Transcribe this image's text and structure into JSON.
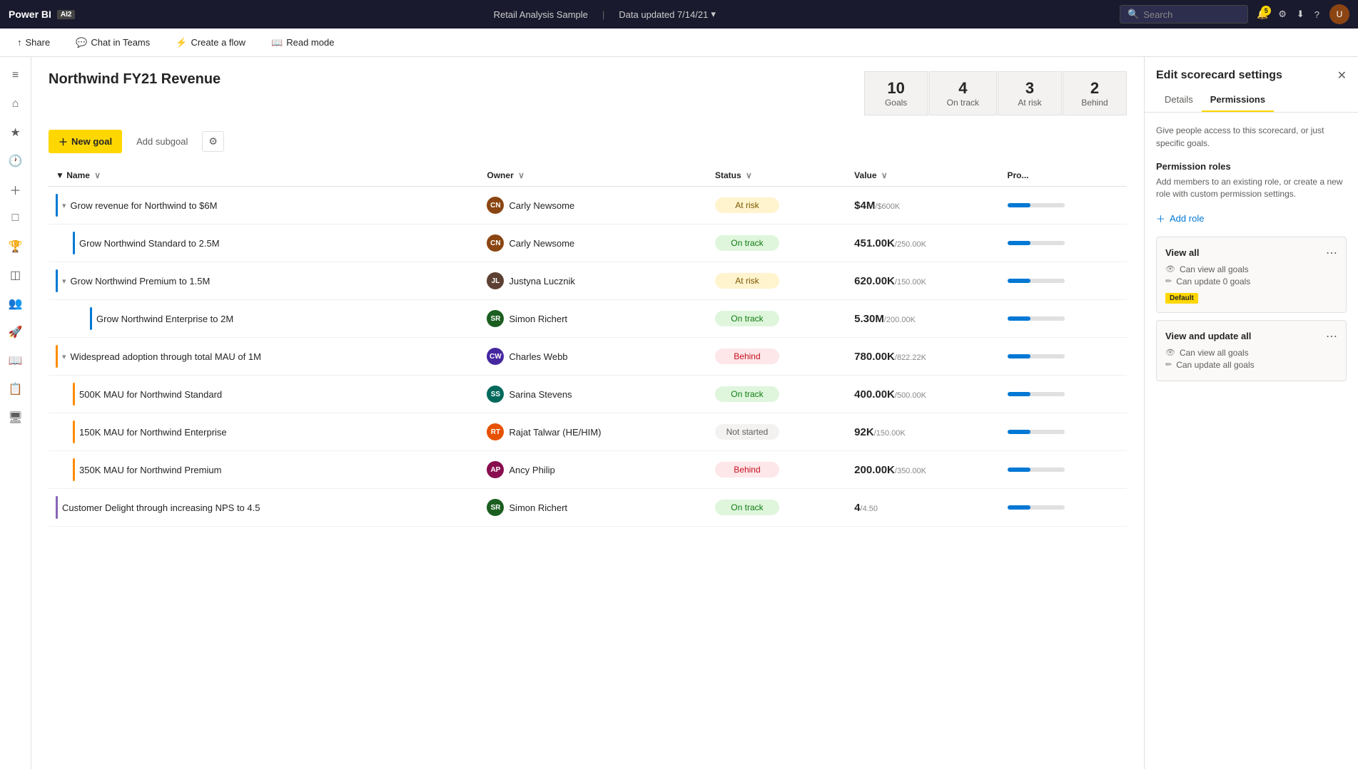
{
  "app": {
    "name": "Power BI",
    "ai_badge": "AI2"
  },
  "topbar": {
    "title": "Retail Analysis Sample",
    "separator": "|",
    "update_text": "Data updated 7/14/21",
    "search_placeholder": "Search",
    "notif_count": "5"
  },
  "secondbar": {
    "share_label": "Share",
    "chat_label": "Chat in Teams",
    "flow_label": "Create a flow",
    "readmode_label": "Read mode"
  },
  "scorecard": {
    "title": "Northwind FY21 Revenue",
    "stats": [
      {
        "value": "10",
        "label": "Goals"
      },
      {
        "value": "4",
        "label": "On track"
      },
      {
        "value": "3",
        "label": "At risk"
      },
      {
        "value": "2",
        "label": "Behind"
      }
    ],
    "toolbar": {
      "new_goal": "New goal",
      "add_subgoal": "Add subgoal"
    },
    "columns": [
      {
        "label": "Name"
      },
      {
        "label": "Owner"
      },
      {
        "label": "Status"
      },
      {
        "label": "Value"
      },
      {
        "label": "Pro..."
      }
    ],
    "goals": [
      {
        "id": 1,
        "name": "Grow revenue for Northwind to $6M",
        "indent": 0,
        "collapsible": true,
        "bar_color": "bar-blue",
        "owner": "Carly Newsome",
        "owner_initials": "CN",
        "owner_color": "#8b4513",
        "status": "At risk",
        "status_class": "status-at-risk",
        "value_main": "$4M",
        "value_sub": "/$600K"
      },
      {
        "id": 2,
        "name": "Grow Northwind Standard to 2.5M",
        "indent": 1,
        "collapsible": false,
        "bar_color": "bar-blue",
        "owner": "Carly Newsome",
        "owner_initials": "CN",
        "owner_color": "#8b4513",
        "status": "On track",
        "status_class": "status-on-track",
        "value_main": "451.00K",
        "value_sub": "/250.00K"
      },
      {
        "id": 3,
        "name": "Grow Northwind Premium to 1.5M",
        "indent": 0,
        "collapsible": true,
        "bar_color": "bar-blue",
        "owner": "Justyna Lucznik",
        "owner_initials": "JL",
        "owner_color": "#5c4033",
        "status": "At risk",
        "status_class": "status-at-risk",
        "value_main": "620.00K",
        "value_sub": "/150.00K"
      },
      {
        "id": 4,
        "name": "Grow Northwind Enterprise to 2M",
        "indent": 2,
        "collapsible": false,
        "bar_color": "bar-blue",
        "owner": "Simon Richert",
        "owner_initials": "SR",
        "owner_color": "#1b5e20",
        "status": "On track",
        "status_class": "status-on-track",
        "value_main": "5.30M",
        "value_sub": "/200.00K"
      },
      {
        "id": 5,
        "name": "Widespread adoption through total MAU of 1M",
        "indent": 0,
        "collapsible": true,
        "bar_color": "bar-orange",
        "owner": "Charles Webb",
        "owner_initials": "CW",
        "owner_color": "#4527a0",
        "status": "Behind",
        "status_class": "status-behind",
        "value_main": "780.00K",
        "value_sub": "/822.22K"
      },
      {
        "id": 6,
        "name": "500K MAU for Northwind Standard",
        "indent": 1,
        "collapsible": false,
        "bar_color": "bar-orange",
        "owner": "Sarina Stevens",
        "owner_initials": "SS",
        "owner_color": "#00695c",
        "status": "On track",
        "status_class": "status-on-track",
        "value_main": "400.00K",
        "value_sub": "/500.00K"
      },
      {
        "id": 7,
        "name": "150K MAU for Northwind Enterprise",
        "indent": 1,
        "collapsible": false,
        "bar_color": "bar-orange",
        "owner": "Rajat Talwar (HE/HIM)",
        "owner_initials": "RT",
        "owner_color": "#e65100",
        "status": "Not started",
        "status_class": "status-not-started",
        "value_main": "92K",
        "value_sub": "/150.00K"
      },
      {
        "id": 8,
        "name": "350K MAU for Northwind Premium",
        "indent": 1,
        "collapsible": false,
        "bar_color": "bar-orange",
        "owner": "Ancy Philip",
        "owner_initials": "AP",
        "owner_color": "#880e4f",
        "status": "Behind",
        "status_class": "status-behind",
        "value_main": "200.00K",
        "value_sub": "/350.00K"
      },
      {
        "id": 9,
        "name": "Customer Delight through increasing NPS to 4.5",
        "indent": 0,
        "collapsible": false,
        "bar_color": "bar-purple",
        "owner": "Simon Richert",
        "owner_initials": "SR",
        "owner_color": "#1b5e20",
        "status": "On track",
        "status_class": "status-on-track",
        "value_main": "4",
        "value_sub": "/4.50"
      }
    ]
  },
  "right_panel": {
    "title": "Edit scorecard settings",
    "tabs": [
      "Details",
      "Permissions"
    ],
    "active_tab": "Permissions",
    "description": "Give people access to this scorecard, or just specific goals.",
    "section_title": "Permission roles",
    "section_sub": "Add members to an existing role, or create a new role with custom permission settings.",
    "add_role_label": "Add role",
    "roles": [
      {
        "title": "View all",
        "perms": [
          "Can view all goals",
          "Can update 0 goals"
        ],
        "badge": "Default",
        "has_badge": true
      },
      {
        "title": "View and update all",
        "perms": [
          "Can view all goals",
          "Can update all goals"
        ],
        "badge": "",
        "has_badge": false
      }
    ]
  },
  "sidebar": {
    "icons": [
      "≡",
      "⌂",
      "★",
      "🕐",
      "+",
      "□",
      "🏆",
      "◫",
      "👥",
      "🚀",
      "📖",
      "📋",
      "🖥"
    ]
  }
}
